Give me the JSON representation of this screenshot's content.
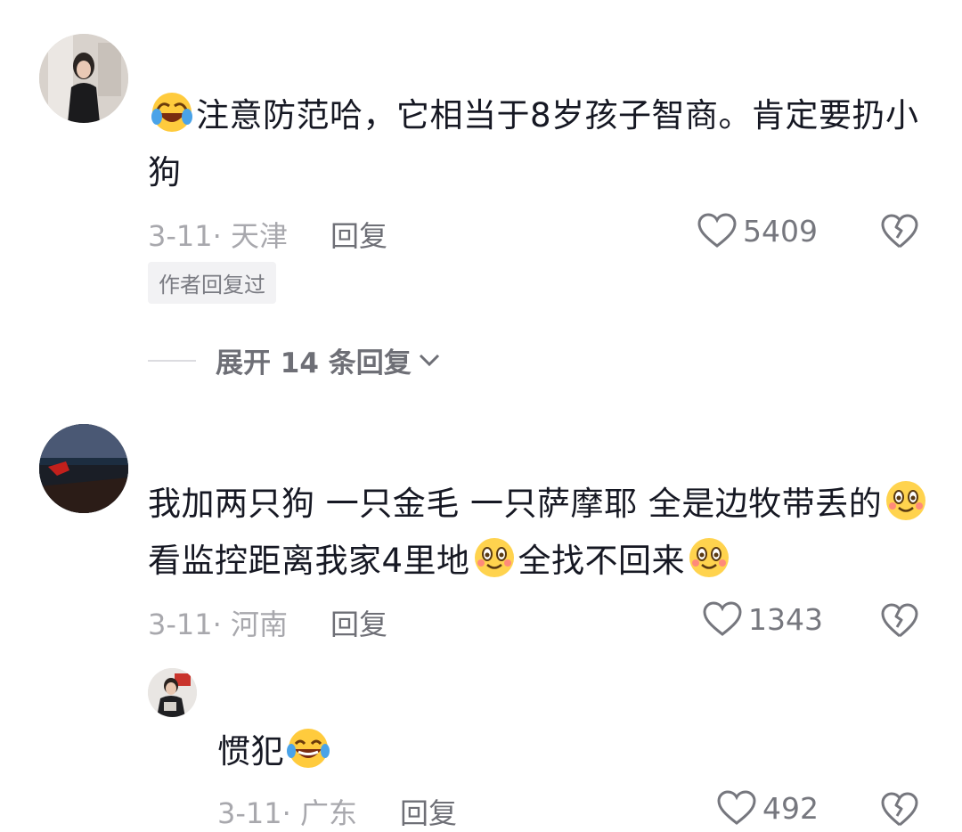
{
  "comments": [
    {
      "avatar_icon": "user-avatar-woman",
      "text_before_emoji": "",
      "emoji1": "laughing-tears-emoji",
      "text": "注意防范哈，它相当于8岁孩子智商。肯定要扔小狗",
      "date_loc": "3-11· 天津",
      "reply_label": "回复",
      "likes": "5409",
      "author_tag": "作者回复过",
      "expand_label": "展开 14 条回复"
    },
    {
      "avatar_icon": "user-avatar-lake",
      "text_part1": "我加两只狗 一只金毛 一只萨摩耶 全是边牧带丢的",
      "text_part2": " 看监控距离我家4里地",
      "text_part3": "全找不回来",
      "emoji": "smile-emoji",
      "date_loc": "3-11· 河南",
      "reply_label": "回复",
      "likes": "1343"
    },
    {
      "avatar_icon": "user-avatar-man",
      "text": "惯犯",
      "emoji": "laughing-tears-emoji",
      "date_loc": "3-11· 广东",
      "reply_label": "回复",
      "likes": "492"
    }
  ],
  "colors": {
    "primary_text": "#161823",
    "meta_text": "#a8a8ad",
    "reply_text": "#6e6f76",
    "tag_bg": "#f2f2f4"
  }
}
